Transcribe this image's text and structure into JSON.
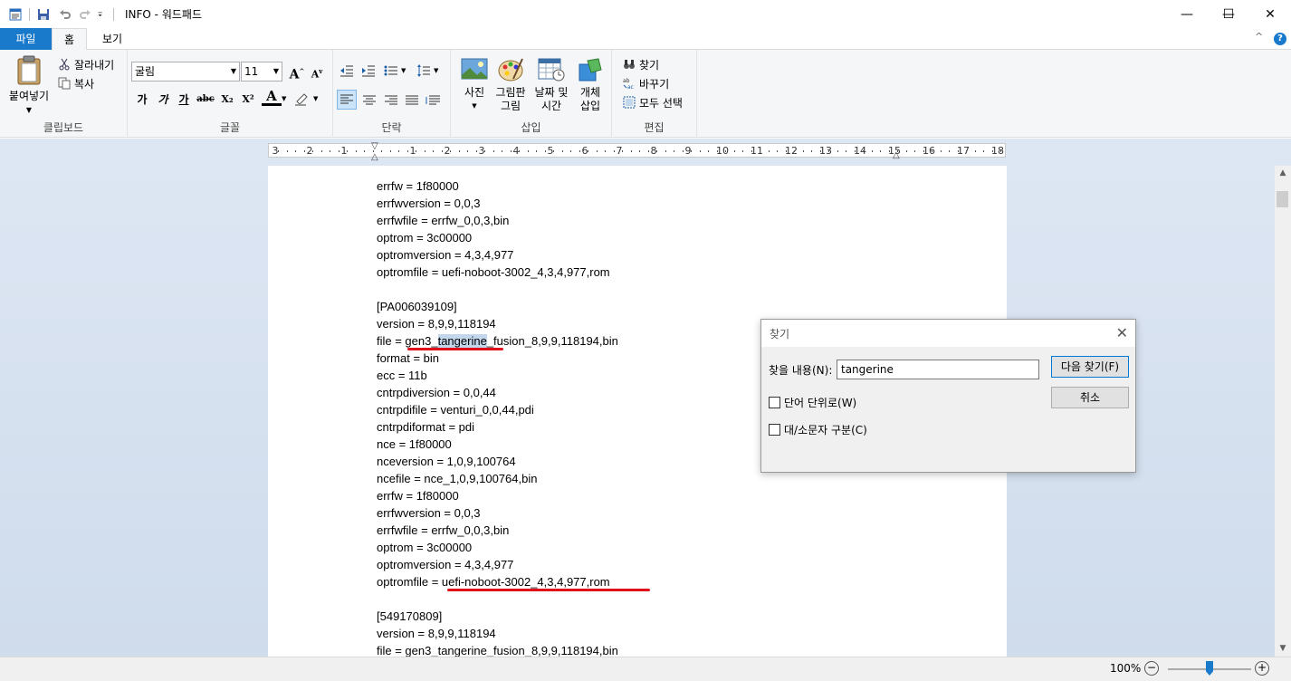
{
  "window": {
    "title": "INFO - 워드패드",
    "minimize_glyph": "—",
    "maximize_glyph": "☐",
    "close_glyph": "✕"
  },
  "ribbon_tabs": [
    "파일",
    "홈",
    "보기"
  ],
  "ribbon_right": {
    "collapse_glyph": "^",
    "help_glyph": "?"
  },
  "clipboard": {
    "paste_label": "붙여넣기",
    "cut_label": "잘라내기",
    "copy_label": "복사",
    "group_label": "클립보드"
  },
  "font": {
    "font_name": "굴림",
    "font_size": "11",
    "group_label": "글꼴",
    "bold": "가",
    "italic": "가",
    "underline": "가",
    "strike": "abc",
    "subscript": "X₂",
    "superscript": "X²",
    "grow": "A",
    "shrink": "A",
    "text_color": "A"
  },
  "paragraph": {
    "group_label": "단락"
  },
  "insert": {
    "picture_label": "사진",
    "paint_label_1": "그림판",
    "paint_label_2": "그림",
    "datetime_label_1": "날짜 및",
    "datetime_label_2": "시간",
    "object_label_1": "개체",
    "object_label_2": "삽입",
    "group_label": "삽입"
  },
  "editing": {
    "find_label": "찾기",
    "replace_label": "바꾸기",
    "select_all_label": "모두 선택",
    "group_label": "편집"
  },
  "ruler": {
    "labels": [
      "3",
      "2",
      "1",
      "1",
      "2",
      "3",
      "4",
      "5",
      "6",
      "7",
      "8",
      "9",
      "10",
      "11",
      "12",
      "13",
      "14",
      "15",
      "16",
      "17",
      "18"
    ]
  },
  "document": {
    "lines": [
      "errfw = 1f80000",
      "errfwversion = 0,0,3",
      "errfwfile = errfw_0,0,3,bin",
      "optrom = 3c00000",
      "optromversion = 4,3,4,977",
      "optromfile = uefi-noboot-3002_4,3,4,977,rom",
      "",
      "[PA006039109]",
      "version = 8,9,9,118194",
      "file = gen3_tangerine_fusion_8,9,9,118194,bin",
      "format = bin",
      "ecc = 11b",
      "cntrpdiversion = 0,0,44",
      "cntrpdifile = venturi_0,0,44,pdi",
      "cntrpdiformat = pdi",
      "nce = 1f80000",
      "nceversion = 1,0,9,100764",
      "ncefile = nce_1,0,9,100764,bin",
      "errfw = 1f80000",
      "errfwversion = 0,0,3",
      "errfwfile = errfw_0,0,3,bin",
      "optrom = 3c00000",
      "optromversion = 4,3,4,977",
      "optromfile = uefi-noboot-3002_4,3,4,977,rom",
      "",
      "[549170809]",
      "version = 8,9,9,118194",
      "file = gen3_tangerine_fusion_8,9,9,118194,bin"
    ],
    "highlight_line": {
      "prefix": "file = gen3_",
      "highlight": "tangerine",
      "suffix": "_fusion_8,9,9,118194,bin"
    }
  },
  "statusbar": {
    "zoom": "100%",
    "zoom_minus": "−",
    "zoom_plus": "+",
    "zoom_level": 0.5
  },
  "find_dialog": {
    "title": "찾기",
    "find_what_label": "찾을 내용(N):",
    "find_what_value": "tangerine",
    "find_next_button": "다음 찾기(F)",
    "cancel_button": "취소",
    "match_whole_word": "단어 단위로(W)",
    "match_case": "대/소문자 구분(C)",
    "close_glyph": "✕"
  },
  "colors": {
    "file_tab": "#1979ca",
    "highlight": "#c2d6ec",
    "annotation_underline": "#e0101c",
    "doc_background": "#dde6f3"
  }
}
